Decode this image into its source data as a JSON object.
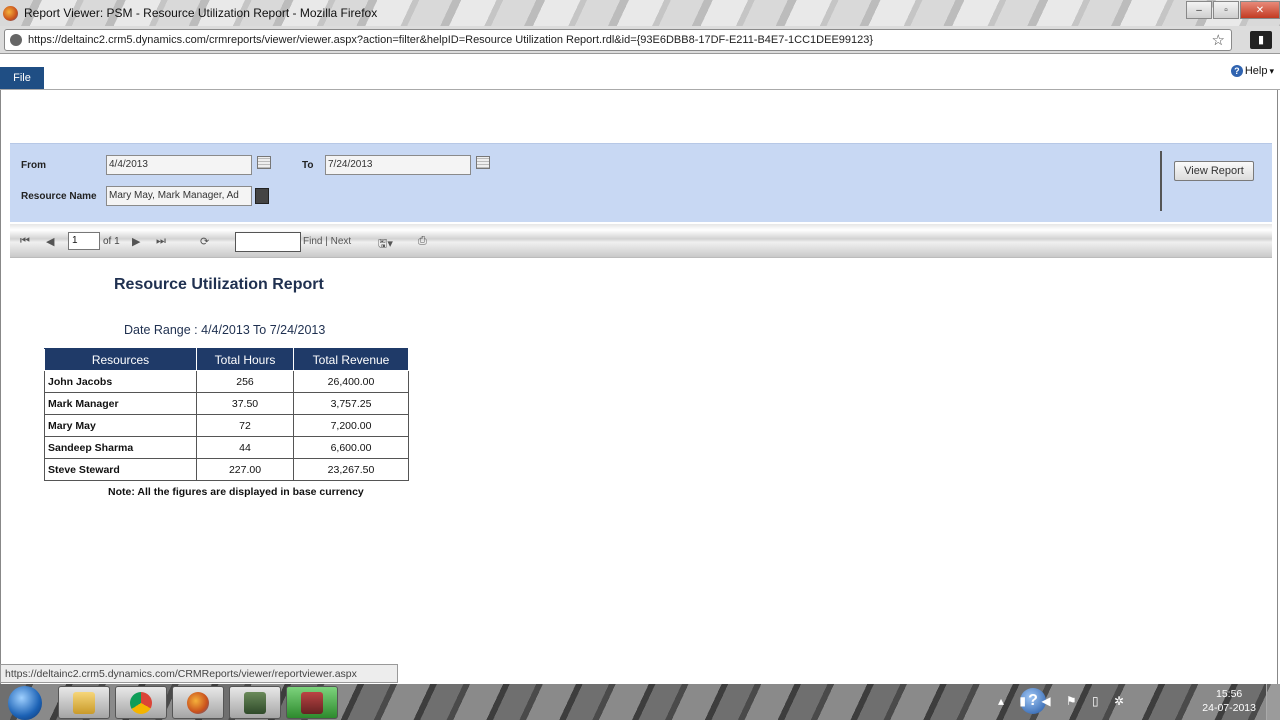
{
  "window": {
    "title": "Report Viewer: PSM - Resource Utilization Report - Mozilla Firefox",
    "minimize": "–",
    "maximize": "▫",
    "close": "✕"
  },
  "browser": {
    "url": "https://deltainc2.crm5.dynamics.com/crmreports/viewer/viewer.aspx?action=filter&helpID=Resource Utilization Report.rdl&id={93E6DBB8-17DF-E211-B4E7-1CC1DEE99123}",
    "status_url": "https://deltainc2.crm5.dynamics.com/CRMReports/viewer/reportviewer.aspx"
  },
  "menu": {
    "file_label": "File",
    "help_label": "Help",
    "help_caret": "▾"
  },
  "params": {
    "from_label": "From",
    "from_value": "4/4/2013",
    "to_label": "To",
    "to_value": "7/24/2013",
    "resource_label": "Resource Name",
    "resource_value": "Mary May, Mark Manager, Ad",
    "view_report_label": "View Report"
  },
  "toolbar": {
    "page_value": "1",
    "page_of": "of 1",
    "find_next_label": "Find | Next"
  },
  "report": {
    "title": "Resource Utilization Report",
    "date_range": "Date Range : 4/4/2013 To 7/24/2013",
    "headers": [
      "Resources",
      "Total Hours",
      "Total Revenue"
    ],
    "rows": [
      {
        "name": "John Jacobs",
        "hours": "256",
        "revenue": "26,400.00"
      },
      {
        "name": "Mark Manager",
        "hours": "37.50",
        "revenue": "3,757.25"
      },
      {
        "name": "Mary May",
        "hours": "72",
        "revenue": "7,200.00"
      },
      {
        "name": "Sandeep Sharma",
        "hours": "44",
        "revenue": "6,600.00"
      },
      {
        "name": "Steve Steward",
        "hours": "227.00",
        "revenue": "23,267.50"
      }
    ],
    "note": "Note: All the figures are displayed in base currency"
  },
  "taskbar": {
    "time": "15:56",
    "date": "24-07-2013"
  }
}
